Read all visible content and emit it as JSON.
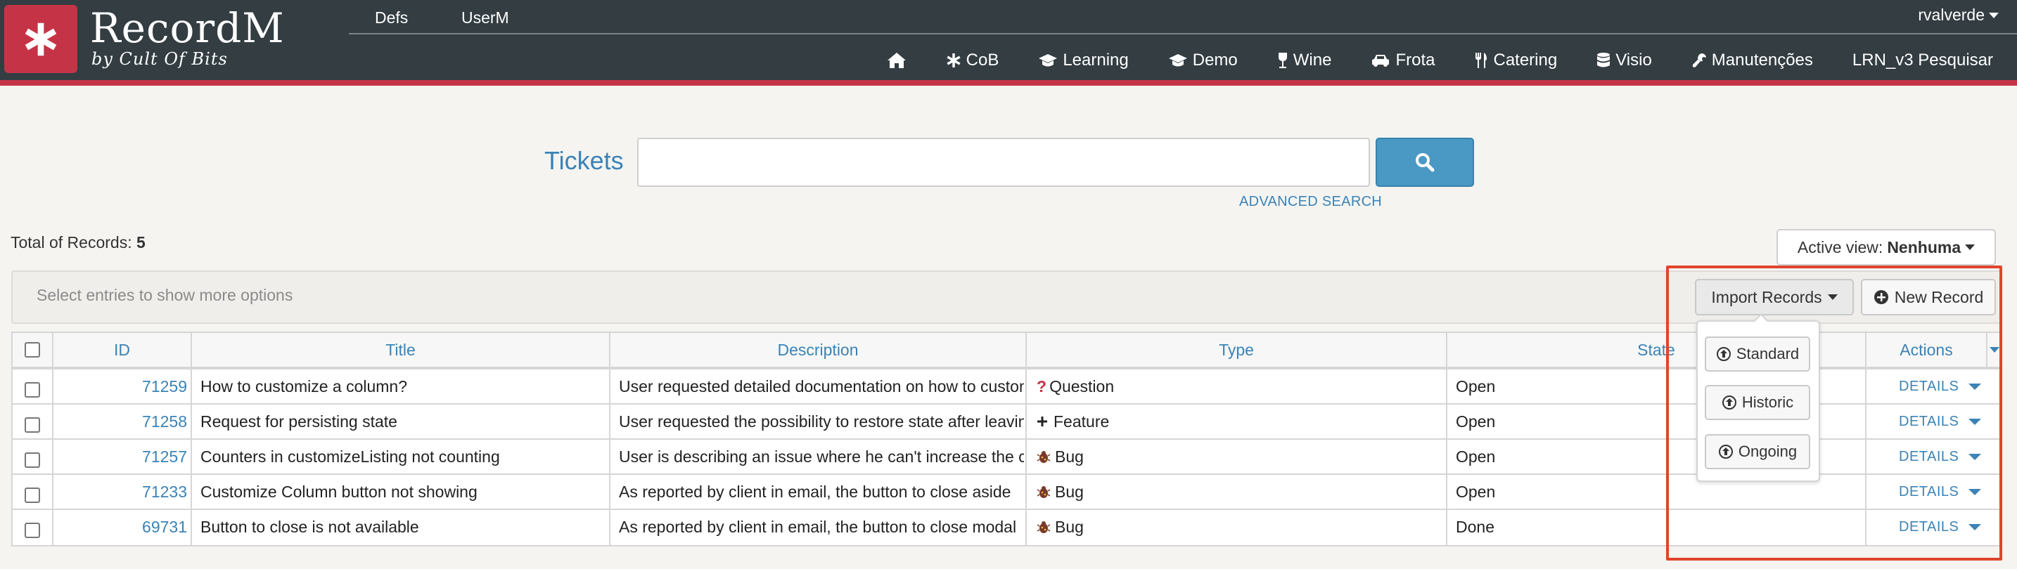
{
  "app": {
    "logo_title": "RecordM",
    "logo_subtitle": "by Cult Of Bits",
    "user": "rvalverde"
  },
  "top_tabs": [
    "Defs",
    "UserM"
  ],
  "nav": [
    {
      "label": "",
      "icon": "home-icon"
    },
    {
      "label": "CoB",
      "icon": "asterisk-icon"
    },
    {
      "label": "Learning",
      "icon": "graduation-cap-icon"
    },
    {
      "label": "Demo",
      "icon": "graduation-cap-icon"
    },
    {
      "label": "Wine",
      "icon": "wine-glass-icon"
    },
    {
      "label": "Frota",
      "icon": "car-icon"
    },
    {
      "label": "Catering",
      "icon": "cutlery-icon"
    },
    {
      "label": "Visio",
      "icon": "database-icon"
    },
    {
      "label": "Manutenções",
      "icon": "wrench-icon"
    },
    {
      "label": "LRN_v3 Pesquisar",
      "icon": ""
    }
  ],
  "search": {
    "label": "Tickets",
    "value": "",
    "placeholder": "",
    "advanced_label": "ADVANCED SEARCH"
  },
  "summary": {
    "total_label": "Total of Records:",
    "total_value": "5",
    "active_view_label": "Active view:",
    "active_view_value": "Nenhuma"
  },
  "toolbar": {
    "hint": "Select entries to show more options",
    "import_label": "Import Records",
    "new_label": "New Record",
    "import_options": [
      "Standard",
      "Historic",
      "Ongoing"
    ]
  },
  "table": {
    "columns": [
      "ID",
      "Title",
      "Description",
      "Type",
      "State",
      "Actions"
    ],
    "rows": [
      {
        "id": "71259",
        "title": "How to customize a column?",
        "description": "User requested detailed documentation on how to customize",
        "type": "Question",
        "type_icon": "question-icon",
        "state": "Open",
        "action": "DETAILS"
      },
      {
        "id": "71258",
        "title": "Request for persisting state",
        "description": "User requested the possibility to restore state after leaving",
        "type": "Feature",
        "type_icon": "plus-icon",
        "state": "Open",
        "action": "DETAILS"
      },
      {
        "id": "71257",
        "title": "Counters in customizeListing not counting",
        "description": "User is describing an issue where he can't increase the counters",
        "type": "Bug",
        "type_icon": "bug-icon",
        "state": "Open",
        "action": "DETAILS"
      },
      {
        "id": "71233",
        "title": "Customize Column button not showing",
        "description": "As reported by client in email, the button to close aside",
        "type": "Bug",
        "type_icon": "bug-icon",
        "state": "Open",
        "action": "DETAILS"
      },
      {
        "id": "69731",
        "title": "Button to close is not available",
        "description": "As reported by client in email, the button to close modal",
        "type": "Bug",
        "type_icon": "bug-icon",
        "state": "Done",
        "action": "DETAILS"
      }
    ]
  },
  "colors": {
    "header_bg": "#333d42",
    "brand_red": "#c53446",
    "link_blue": "#3b83b6",
    "search_button": "#4a98c4",
    "highlight": "#e0452c"
  }
}
